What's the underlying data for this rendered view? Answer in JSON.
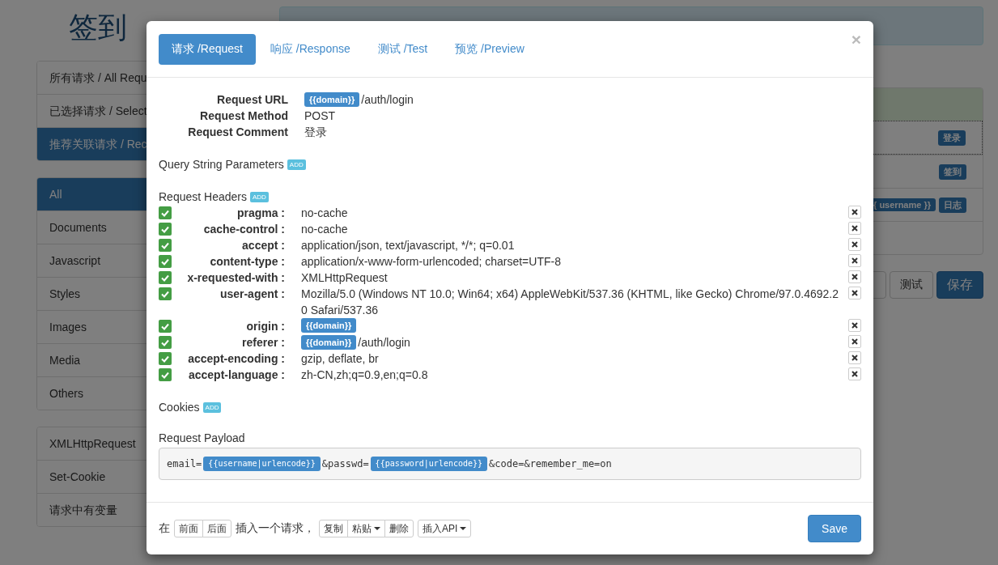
{
  "page": {
    "title": "签到",
    "request_groups": [
      {
        "label": "所有请求 / All Requ",
        "selected": false
      },
      {
        "label": "已选择请求 / Select",
        "selected": false
      },
      {
        "label": "推荐关联请求 / Rec",
        "selected": true
      }
    ],
    "type_filters": [
      {
        "label": "All",
        "selected": true
      },
      {
        "label": "Documents",
        "selected": false
      },
      {
        "label": "Javascript",
        "selected": false
      },
      {
        "label": "Styles",
        "selected": false
      },
      {
        "label": "Images",
        "selected": false
      },
      {
        "label": "Media",
        "selected": false
      },
      {
        "label": "Others",
        "selected": false
      }
    ],
    "extra_filters": [
      {
        "label": "XMLHttpRequest"
      },
      {
        "label": "Set-Cookie"
      },
      {
        "label": "请求中有变量"
      }
    ],
    "request_rows": [
      {
        "tags": [
          "登录"
        ],
        "selected": true
      },
      {
        "tags": [
          "签到"
        ],
        "selected": false
      },
      {
        "tags": [
          "{ username }}",
          "日志"
        ],
        "selected": false
      }
    ],
    "buttons": [
      "测试",
      "保存"
    ]
  },
  "modal": {
    "close": "×",
    "tabs": [
      {
        "label": "请求 /Request",
        "selected": true
      },
      {
        "label": "响应 /Response",
        "selected": false
      },
      {
        "label": "测试 /Test",
        "selected": false
      },
      {
        "label": "预览 /Preview",
        "selected": false
      }
    ],
    "summary": [
      {
        "label": "Request URL",
        "parts": [
          {
            "kind": "var",
            "text": "{{domain}}"
          },
          {
            "kind": "text",
            "text": "/auth/login"
          }
        ]
      },
      {
        "label": "Request Method",
        "parts": [
          {
            "kind": "text",
            "text": "POST"
          }
        ]
      },
      {
        "label": "Request Comment",
        "parts": [
          {
            "kind": "text",
            "text": "登录"
          }
        ]
      }
    ],
    "query_title": "Query String Parameters",
    "query_add": "ADD",
    "headers_title": "Request Headers",
    "headers_add": "ADD",
    "headers": [
      {
        "enabled": true,
        "name": "pragma :",
        "parts": [
          {
            "kind": "text",
            "text": "no-cache"
          }
        ]
      },
      {
        "enabled": true,
        "name": "cache-control :",
        "parts": [
          {
            "kind": "text",
            "text": "no-cache"
          }
        ]
      },
      {
        "enabled": true,
        "name": "accept :",
        "parts": [
          {
            "kind": "text",
            "text": "application/json, text/javascript, */*; q=0.01"
          }
        ]
      },
      {
        "enabled": true,
        "name": "content-type :",
        "parts": [
          {
            "kind": "text",
            "text": "application/x-www-form-urlencoded; charset=UTF-8"
          }
        ]
      },
      {
        "enabled": true,
        "name": "x-requested-with :",
        "parts": [
          {
            "kind": "text",
            "text": "XMLHttpRequest"
          }
        ]
      },
      {
        "enabled": true,
        "name": "user-agent :",
        "parts": [
          {
            "kind": "text",
            "text": "Mozilla/5.0 (Windows NT 10.0; Win64; x64) AppleWebKit/537.36 (KHTML, like Gecko) Chrome/97.0.4692.20 Safari/537.36"
          }
        ]
      },
      {
        "enabled": true,
        "name": "origin :",
        "parts": [
          {
            "kind": "var",
            "text": "{{domain}}"
          }
        ]
      },
      {
        "enabled": true,
        "name": "referer :",
        "parts": [
          {
            "kind": "var",
            "text": "{{domain}}"
          },
          {
            "kind": "text",
            "text": "/auth/login"
          }
        ]
      },
      {
        "enabled": true,
        "name": "accept-encoding :",
        "parts": [
          {
            "kind": "text",
            "text": "gzip, deflate, br"
          }
        ]
      },
      {
        "enabled": true,
        "name": "accept-language :",
        "parts": [
          {
            "kind": "text",
            "text": "zh-CN,zh;q=0.9,en;q=0.8"
          }
        ]
      }
    ],
    "cookies_title": "Cookies",
    "cookies_add": "ADD",
    "payload_title": "Request Payload",
    "payload": [
      {
        "kind": "text",
        "text": "email="
      },
      {
        "kind": "var",
        "text": "{{username|urlencode}}"
      },
      {
        "kind": "text",
        "text": "&passwd="
      },
      {
        "kind": "var",
        "text": "{{password|urlencode}}"
      },
      {
        "kind": "text",
        "text": "&code=&remember_me=on"
      }
    ],
    "footer": {
      "prefix": "在",
      "position_buttons": [
        "前面",
        "后面"
      ],
      "middle": "插入一个请求，",
      "edit_buttons": [
        {
          "label": "复制",
          "caret": false
        },
        {
          "label": "粘贴",
          "caret": true
        },
        {
          "label": "删除",
          "caret": false
        }
      ],
      "api_button": {
        "label": "插入API",
        "caret": true
      },
      "save": "Save"
    }
  }
}
